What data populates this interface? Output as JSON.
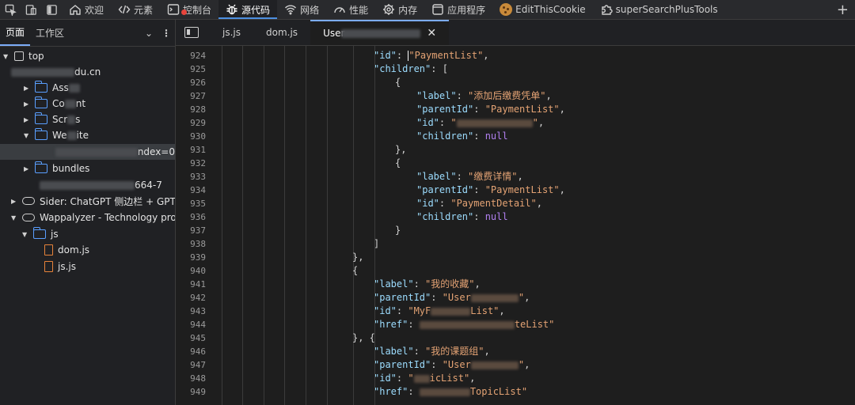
{
  "toolbar": {
    "tabs": [
      {
        "label": "欢迎",
        "icon": "home-icon"
      },
      {
        "label": "元素",
        "icon": "code-brackets-icon"
      },
      {
        "label": "控制台",
        "icon": "console-icon"
      },
      {
        "label": "源代码",
        "icon": "bug-icon"
      },
      {
        "label": "网络",
        "icon": "wifi-icon"
      },
      {
        "label": "性能",
        "icon": "gauge-icon"
      },
      {
        "label": "内存",
        "icon": "memory-chip-icon"
      },
      {
        "label": "应用程序",
        "icon": "application-icon"
      },
      {
        "label": "EditThisCookie",
        "icon": "cookie-icon"
      },
      {
        "label": "superSearchPlusTools",
        "icon": "puzzle-piece-icon"
      }
    ],
    "active_tab": "源代码"
  },
  "navigator": {
    "tabs": [
      "页面",
      "工作区"
    ],
    "tree": {
      "top": "top",
      "domain_suffix": "du.cn",
      "assets": "Ass",
      "content": "Co",
      "content_tail": "nt",
      "scripts": "Scr",
      "scripts_tail": "s",
      "website": "We",
      "website_tail": "ite",
      "selected_suffix": "ndex=0",
      "bundles": "bundles",
      "hash_suffix": "664-7",
      "sider": "Sider: ChatGPT 侧边栏 + GPT-4",
      "wappalyzer": "Wappalyzer - Technology profil",
      "js_folder": "js",
      "dom_file": "dom.js",
      "js_file": "js.js"
    }
  },
  "editor": {
    "tabs": [
      {
        "label": "js.js"
      },
      {
        "label": "dom.js"
      },
      {
        "label": "User",
        "active": true
      }
    ],
    "code": {
      "parentId_key": "\"parentId\"",
      "id_key": "\"id\"",
      "label_key": "\"label\"",
      "children_key": "\"children\"",
      "href_key": "\"href\"",
      "l924_value": "PaymentList\"",
      "l927_value": "\"添加后缴费凭单\"",
      "l928_value": "\"PaymentList\"",
      "l929_value_start": "\"",
      "l929_value_end": "\"",
      "null": "null",
      "l933_value": "\"缴费详情\"",
      "l934_value": "\"PaymentList\"",
      "l935_value": "\"PaymentDetail\"",
      "l941_value": "\"我的收藏\"",
      "l942_value_start": "\"User",
      "l942_value_end": "\"",
      "l943_value_start": "\"MyF",
      "l943_value_end": "List\"",
      "l944_value_end": "teList\"",
      "l946_value": "\"我的课题组\"",
      "l947_value_start": "\"User",
      "l947_value_end": "\"",
      "l948_value_start": "\"",
      "l948_value_end": "icList\"",
      "l949_value_end": "TopicList\""
    }
  }
}
